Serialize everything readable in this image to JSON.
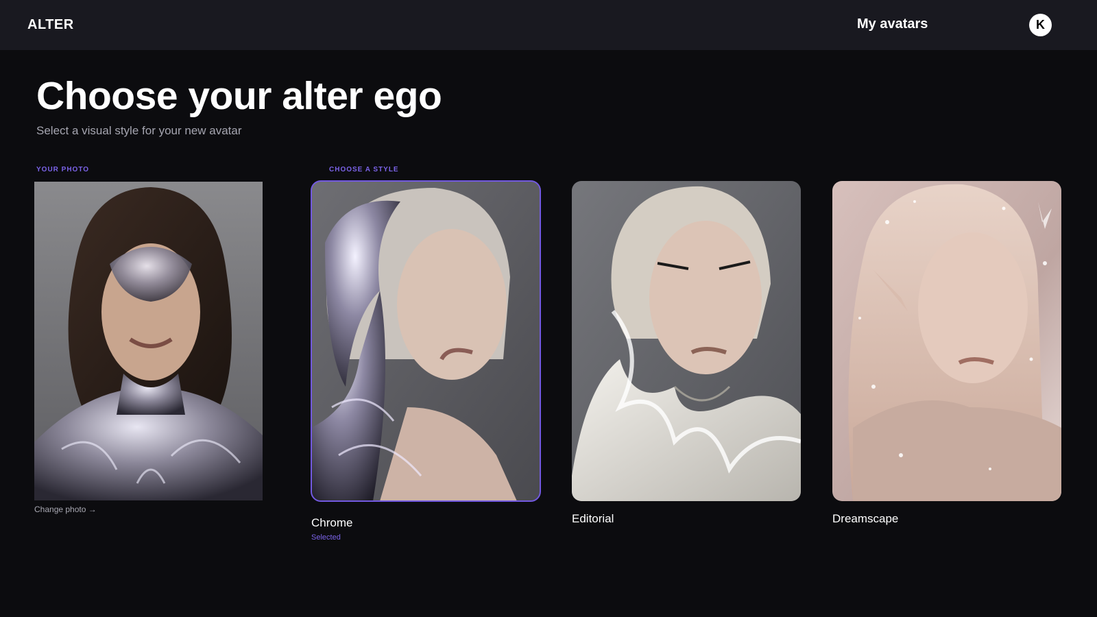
{
  "header": {
    "brand": "ALTER",
    "nav_link": "My avatars",
    "avatar_initial": "K"
  },
  "main": {
    "title": "Choose your alter ego",
    "subtitle": "Select a visual style for your new avatar",
    "your_photo_label": "YOUR PHOTO",
    "choose_style_label": "CHOOSE A STYLE",
    "change_photo": "Change photo →"
  },
  "styles": [
    {
      "label": "Chrome",
      "status": "Selected",
      "selected": true
    },
    {
      "label": "Editorial",
      "status": "",
      "selected": false
    },
    {
      "label": "Dreamscape",
      "status": "",
      "selected": false
    }
  ],
  "colors": {
    "accent": "#7259e0",
    "background": "#0c0c0f",
    "topbar": "#191920"
  },
  "icons": {
    "change_photo_arrow": "arrow-right-icon"
  }
}
